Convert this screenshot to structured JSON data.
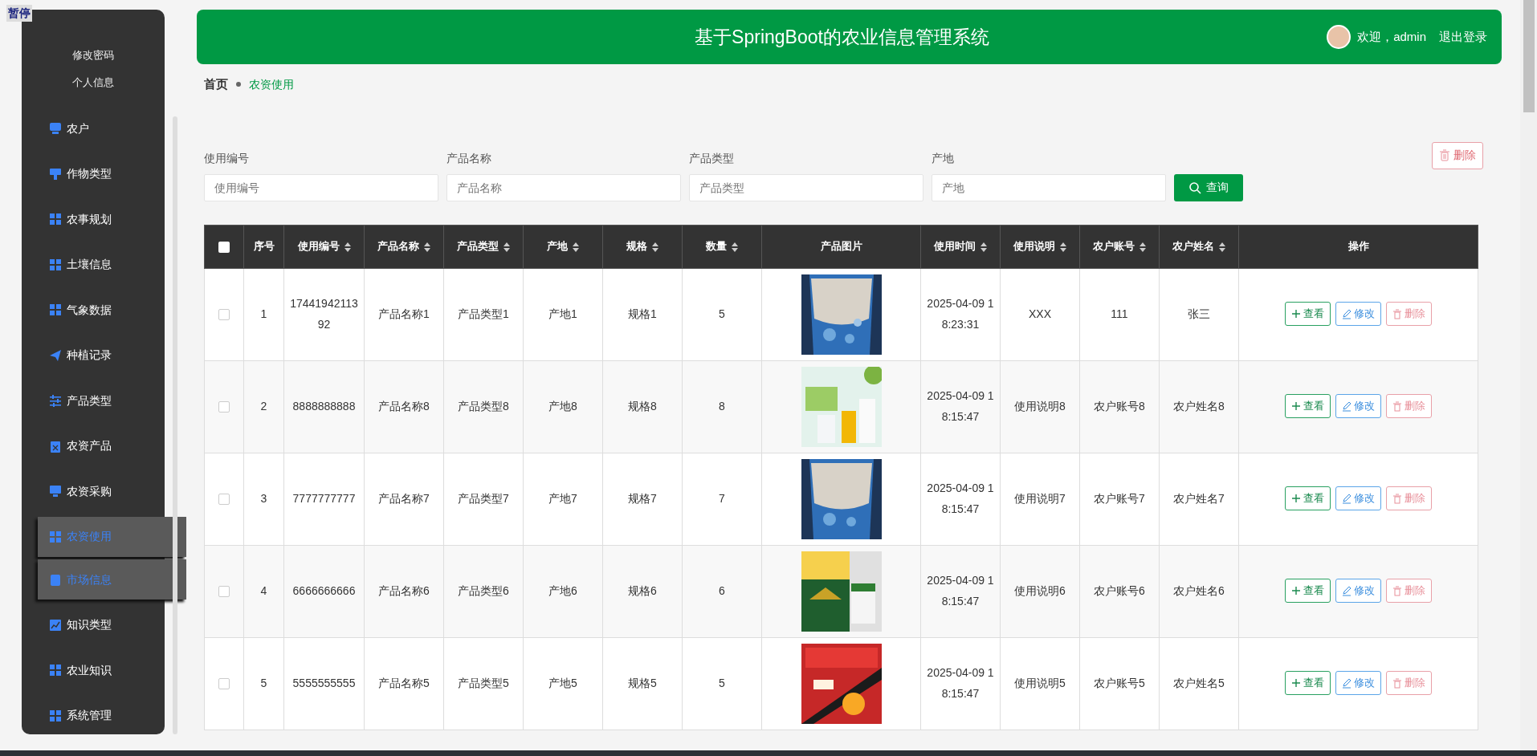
{
  "overlay_label": "暂停",
  "sidebar": {
    "account_links": [
      "修改密码",
      "个人信息"
    ],
    "items": [
      {
        "label": "农户",
        "highlighted": false
      },
      {
        "label": "作物类型",
        "highlighted": false
      },
      {
        "label": "农事规划",
        "highlighted": false
      },
      {
        "label": "土壤信息",
        "highlighted": false
      },
      {
        "label": "气象数据",
        "highlighted": false
      },
      {
        "label": "种植记录",
        "highlighted": false
      },
      {
        "label": "产品类型",
        "highlighted": false
      },
      {
        "label": "农资产品",
        "highlighted": false
      },
      {
        "label": "农资采购",
        "highlighted": false
      },
      {
        "label": "农资使用",
        "highlighted": true
      },
      {
        "label": "市场信息",
        "highlighted": true
      },
      {
        "label": "知识类型",
        "highlighted": false
      },
      {
        "label": "农业知识",
        "highlighted": false
      },
      {
        "label": "系统管理",
        "highlighted": false
      }
    ]
  },
  "header": {
    "title": "基于SpringBoot的农业信息管理系统",
    "welcome": "欢迎，admin",
    "logout": "退出登录"
  },
  "breadcrumb": [
    {
      "label": "首页",
      "current": false
    },
    {
      "label": "农资使用",
      "current": true
    }
  ],
  "filters": [
    {
      "label": "使用编号",
      "placeholder": "使用编号"
    },
    {
      "label": "产品名称",
      "placeholder": "产品名称"
    },
    {
      "label": "产品类型",
      "placeholder": "产品类型"
    },
    {
      "label": "产地",
      "placeholder": "产地"
    }
  ],
  "search_button": "查询",
  "bulk_delete_button": "删除",
  "table": {
    "select_all_checked": false,
    "columns": [
      {
        "label": "序号",
        "sortable": false
      },
      {
        "label": "使用编号",
        "sortable": true
      },
      {
        "label": "产品名称",
        "sortable": true
      },
      {
        "label": "产品类型",
        "sortable": true
      },
      {
        "label": "产地",
        "sortable": true
      },
      {
        "label": "规格",
        "sortable": true
      },
      {
        "label": "数量",
        "sortable": true
      },
      {
        "label": "产品图片",
        "sortable": false
      },
      {
        "label": "使用时间",
        "sortable": true
      },
      {
        "label": "使用说明",
        "sortable": true
      },
      {
        "label": "农户账号",
        "sortable": true
      },
      {
        "label": "农户姓名",
        "sortable": true
      },
      {
        "label": "操作",
        "sortable": false
      }
    ],
    "rows": [
      {
        "checked": false,
        "cells": [
          "1",
          "17441942113 92",
          "产品名称1",
          "产品类型1",
          "产地1",
          "规格1",
          "5"
        ],
        "image": {
          "kind": "picture"
        },
        "after": [
          "2025-04-09 1 8:23:31",
          "XXX",
          "111",
          "张三"
        ],
        "actions": [
          "查看",
          "修改",
          "删除"
        ]
      },
      {
        "checked": false,
        "cells": [
          "2",
          "8888888888",
          "产品名称8",
          "产品类型8",
          "产地8",
          "规格8",
          "8"
        ],
        "image": {
          "kind": "picture"
        },
        "after": [
          "2025-04-09 1 8:15:47",
          "使用说明8",
          "农户账号8",
          "农户姓名8"
        ],
        "actions": [
          "查看",
          "修改",
          "删除"
        ]
      },
      {
        "checked": false,
        "cells": [
          "3",
          "7777777777",
          "产品名称7",
          "产品类型7",
          "产地7",
          "规格7",
          "7"
        ],
        "image": {
          "kind": "picture"
        },
        "after": [
          "2025-04-09 1 8:15:47",
          "使用说明7",
          "农户账号7",
          "农户姓名7"
        ],
        "actions": [
          "查看",
          "修改",
          "删除"
        ]
      },
      {
        "checked": false,
        "cells": [
          "4",
          "6666666666",
          "产品名称6",
          "产品类型6",
          "产地6",
          "规格6",
          "6"
        ],
        "image": {
          "kind": "picture"
        },
        "after": [
          "2025-04-09 1 8:15:47",
          "使用说明6",
          "农户账号6",
          "农户姓名6"
        ],
        "actions": [
          "查看",
          "修改",
          "删除"
        ]
      },
      {
        "checked": false,
        "cells": [
          "5",
          "5555555555",
          "产品名称5",
          "产品类型5",
          "产地5",
          "规格5",
          "5"
        ],
        "image": {
          "kind": "picture"
        },
        "after": [
          "2025-04-09 1 8:15:47",
          "使用说明5",
          "农户账号5",
          "农户姓名5"
        ],
        "actions": [
          "查看",
          "修改",
          "删除"
        ]
      }
    ]
  }
}
